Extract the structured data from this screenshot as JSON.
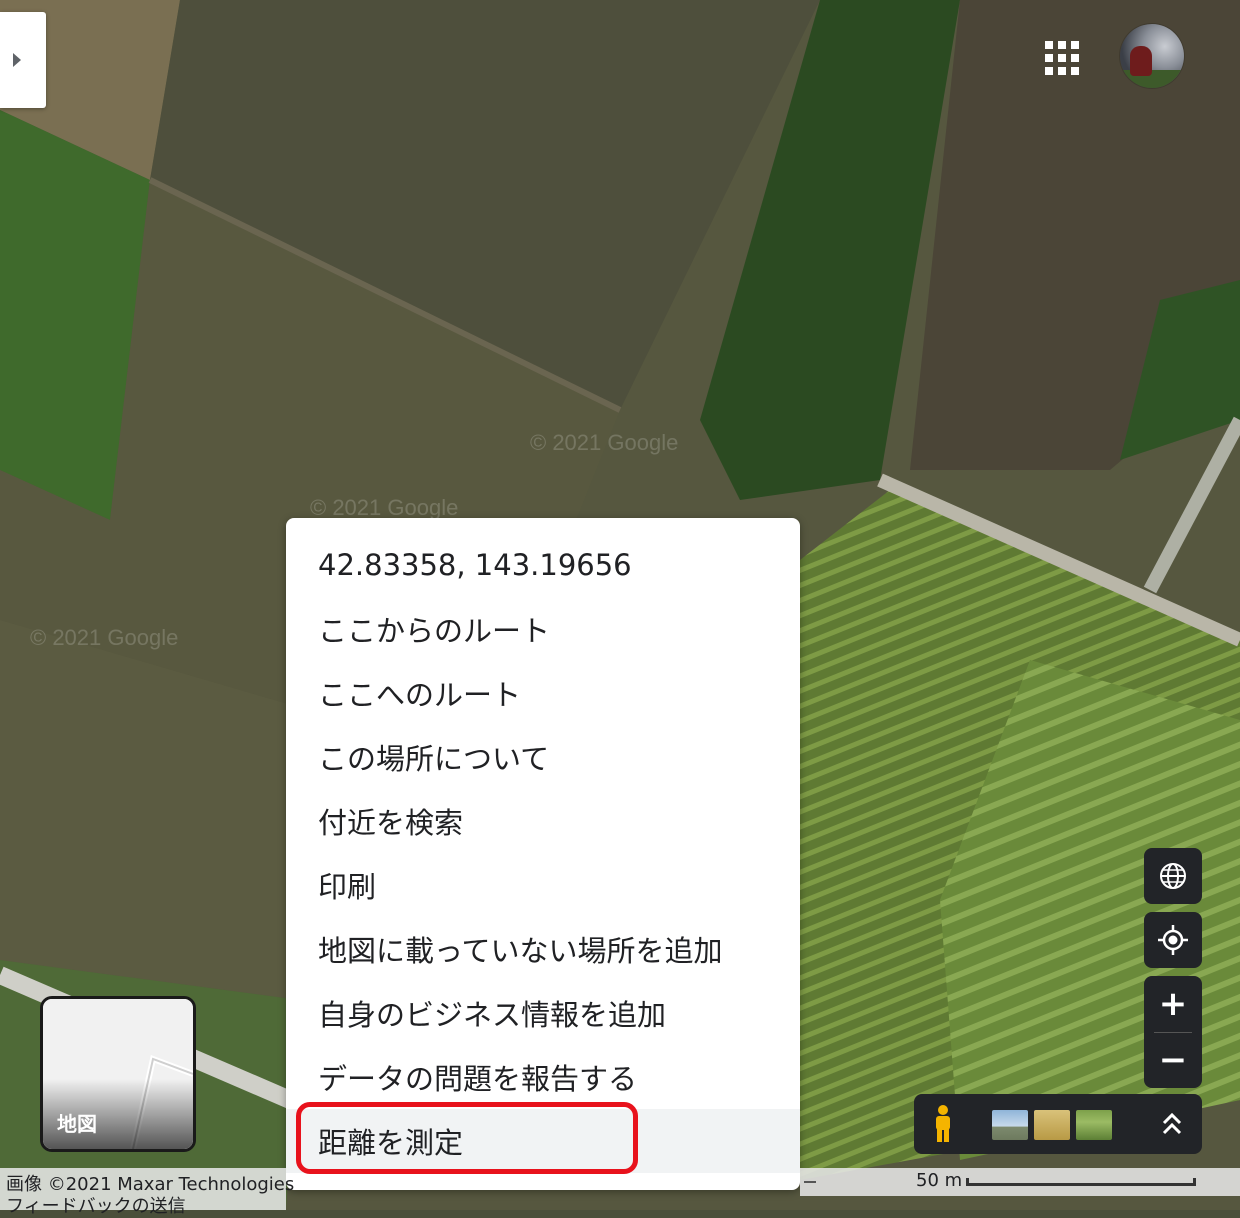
{
  "map": {
    "watermark": "© 2021 Google",
    "layer_toggle_label": "地図",
    "apps_icon": "apps-grid-icon",
    "account_icon": "avatar"
  },
  "context_menu": {
    "items": [
      {
        "label": "42.83358, 143.19656"
      },
      {
        "label": "ここからのルート"
      },
      {
        "label": "ここへのルート"
      },
      {
        "label": "この場所について"
      },
      {
        "label": "付近を検索"
      },
      {
        "label": "印刷"
      },
      {
        "label": "地図に載っていない場所を追加"
      },
      {
        "label": "自身のビジネス情報を追加"
      },
      {
        "label": "データの問題を報告する"
      },
      {
        "label": "距離を測定"
      }
    ],
    "highlight_color": "#e8121c"
  },
  "controls": {
    "globe_icon": "globe-icon",
    "location_icon": "my-location-icon",
    "zoom_in_symbol": "+",
    "zoom_out_symbol": "−",
    "pegman_icon": "pegman-icon",
    "expand_icon": "expand-up-icon"
  },
  "footer": {
    "imagery_credit": "画像 ©2021 Maxar Technologies",
    "feedback": "フィードバックの送信",
    "scale": "50 m"
  }
}
